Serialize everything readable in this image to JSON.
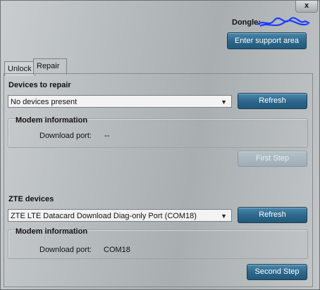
{
  "window": {
    "close_label": "x"
  },
  "header": {
    "dongle_label": "Dongle:",
    "support_button": "Enter support area"
  },
  "tabs": [
    {
      "label": "Unlock"
    },
    {
      "label": "Repair"
    }
  ],
  "repair": {
    "devices_title": "Devices to repair",
    "device_select": "No devices present",
    "refresh_label": "Refresh",
    "modem_title": "Modem information",
    "download_port_label": "Download port:",
    "download_port_value": "--",
    "first_step_label": "First Step"
  },
  "zte": {
    "devices_title": "ZTE devices",
    "device_select": "ZTE LTE Datacard Download Diag-only Port (COM18)",
    "refresh_label": "Refresh",
    "modem_title": "Modem information",
    "download_port_label": "Download port:",
    "download_port_value": "COM18",
    "second_step_label": "Second Step"
  },
  "icons": {
    "dropdown": "filter-arrow-icon",
    "redaction": "scribble-redaction"
  }
}
